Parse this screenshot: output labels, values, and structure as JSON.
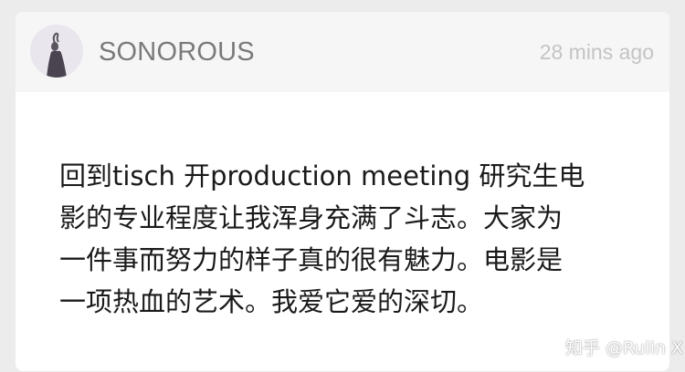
{
  "post": {
    "author": "SONOROUS",
    "time_ago": "28 mins ago",
    "avatar_icon": "profile-photo-icon",
    "text": "回到tisch 开production meeting 研究生电\n影的专业程度让我浑身充满了斗志。大家为\n一件事而努力的样子真的很有魅力。电影是\n一项热血的艺术。我爱它爱的深切。"
  },
  "watermark": {
    "text": "知乎 @Rulin X"
  },
  "colors": {
    "background": "#ececec",
    "card": "#ffffff",
    "header": "#f6f6f6",
    "author_text": "#7a7a7a",
    "time_text": "#c4c4c4",
    "body_text": "#1a1a1a"
  }
}
